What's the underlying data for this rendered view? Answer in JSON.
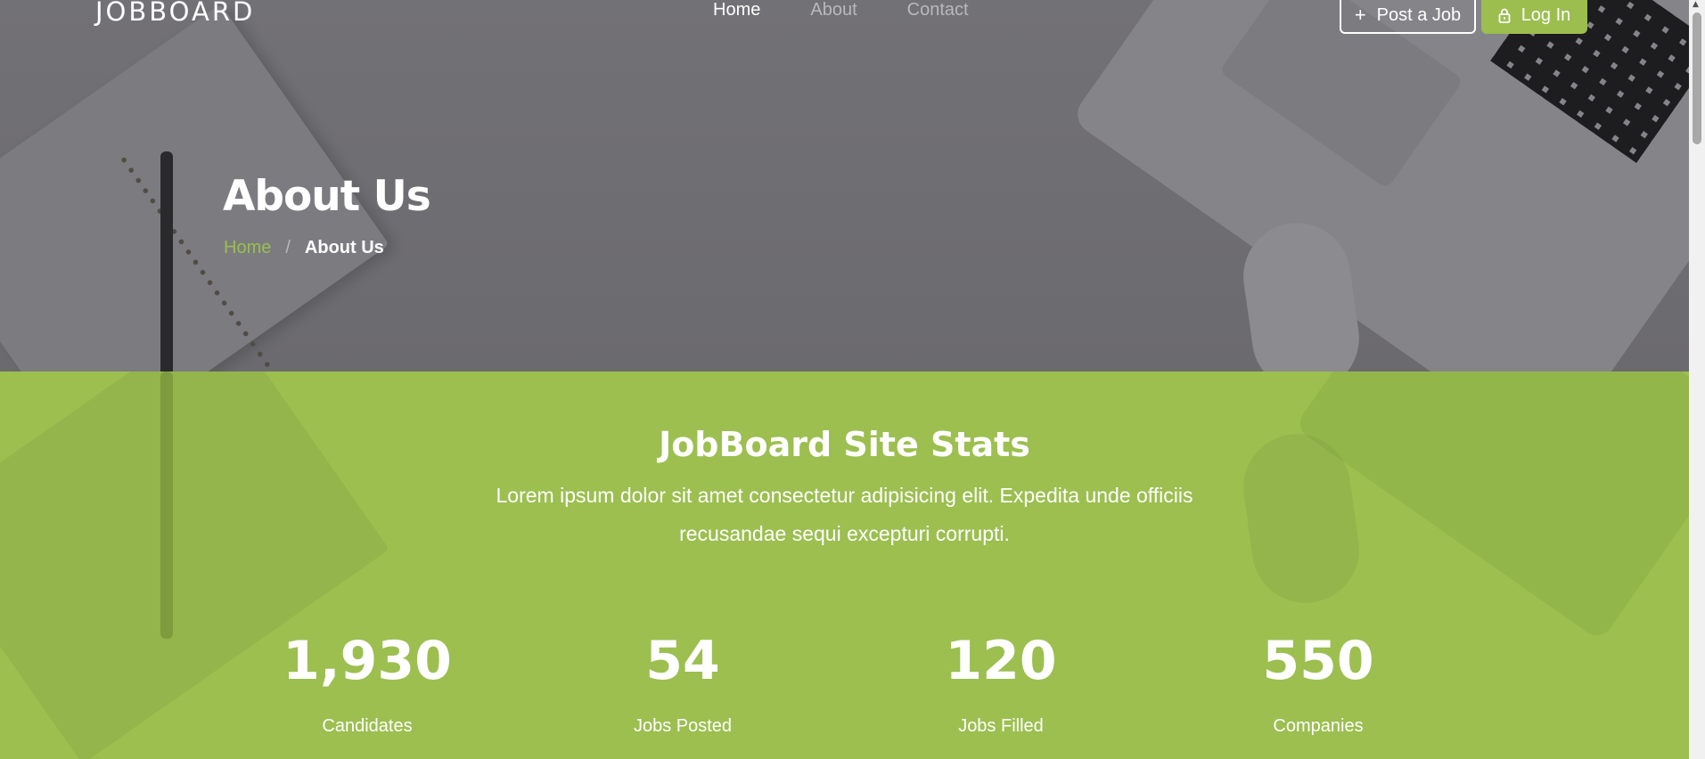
{
  "navbar": {
    "logo": "JOBBOARD",
    "links": [
      "Home",
      "About",
      "Contact"
    ],
    "active_link": "Home",
    "post_job_label": "Post a Job",
    "login_label": "Log In"
  },
  "header": {
    "title": "About Us",
    "breadcrumb": {
      "home": "Home",
      "separator": "/",
      "current": "About Us"
    }
  },
  "stats": {
    "title": "JobBoard Site Stats",
    "description": "Lorem ipsum dolor sit amet consectetur adipisicing elit. Expedita unde officiis recusandae sequi excepturi corrupti.",
    "items": [
      {
        "value": "1,930",
        "label": "Candidates"
      },
      {
        "value": "54",
        "label": "Jobs Posted"
      },
      {
        "value": "120",
        "label": "Jobs Filled"
      },
      {
        "value": "550",
        "label": "Companies"
      }
    ]
  },
  "colors": {
    "accent": "#9cbf50",
    "hero_overlay": "#6f6e72"
  },
  "icons": {
    "post_job": "plus-icon",
    "login": "lock-icon"
  }
}
